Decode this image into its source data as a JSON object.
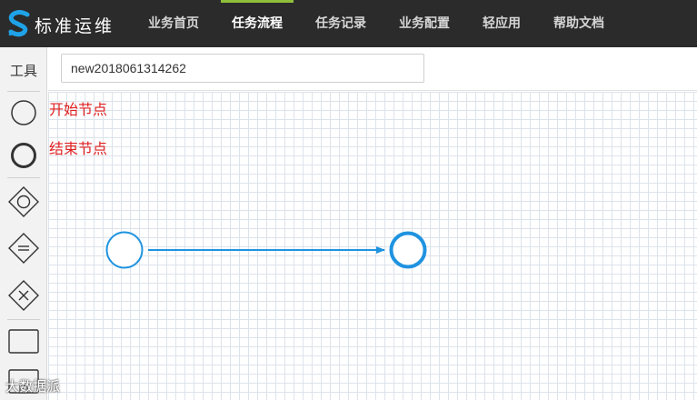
{
  "app": {
    "brand": "标准运维",
    "colors": {
      "topbar": "#2b2b2b",
      "accent": "#8fbf3a",
      "flow": "#1f93e0",
      "label": "#e02020"
    }
  },
  "nav": {
    "items": [
      {
        "label": "业务首页",
        "active": false
      },
      {
        "label": "任务流程",
        "active": true
      },
      {
        "label": "任务记录",
        "active": false
      },
      {
        "label": "业务配置",
        "active": false
      },
      {
        "label": "轻应用",
        "active": false
      },
      {
        "label": "帮助文档",
        "active": false
      }
    ]
  },
  "sidebar": {
    "title": "工具",
    "tools": [
      {
        "name": "start-node",
        "icon": "circle-thin-icon"
      },
      {
        "name": "end-node",
        "icon": "circle-thick-icon"
      },
      {
        "name": "parallel-gateway",
        "icon": "diamond-circle-icon"
      },
      {
        "name": "converge-gateway",
        "icon": "diamond-equals-icon"
      },
      {
        "name": "exclusive-gateway",
        "icon": "diamond-x-icon"
      },
      {
        "name": "task-node",
        "icon": "rectangle-icon"
      },
      {
        "name": "subprocess-node",
        "icon": "rectangle-plus-icon"
      }
    ]
  },
  "editor": {
    "template_name": "new2018061314262"
  },
  "canvas": {
    "start_label": "开始节点",
    "end_label": "结束节点"
  },
  "watermark": "大数据派"
}
